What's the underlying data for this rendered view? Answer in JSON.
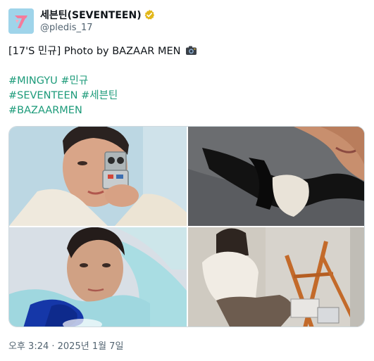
{
  "account": {
    "display_name": "세븐틴(SEVENTEEN)",
    "handle": "@pledis_17",
    "verified_icon": "verified-gold-badge-icon",
    "avatar_icon": "seventeen-logo-avatar"
  },
  "tweet": {
    "line1": "[17'S 민규] Photo by BAZAAR MEN",
    "line1_emoji": "camera-flash-icon",
    "hashtags": {
      "h1": "#MINGYU",
      "h2": "#민규",
      "h3": "#SEVENTEEN",
      "h4": "#세븐틴",
      "h5": "#BAZAARMEN"
    },
    "hashtag_color": "#1d9b7a"
  },
  "media": {
    "photos": [
      {
        "name": "photo-1",
        "alt": "Portrait holding toy robot"
      },
      {
        "name": "photo-2",
        "alt": "Close-up with black scarf"
      },
      {
        "name": "photo-3",
        "alt": "Portrait in light blue shirt"
      },
      {
        "name": "photo-4",
        "alt": "Seated beside wooden easel"
      }
    ]
  },
  "timestamp": "오후 3:24 · 2025년 1월 7일"
}
